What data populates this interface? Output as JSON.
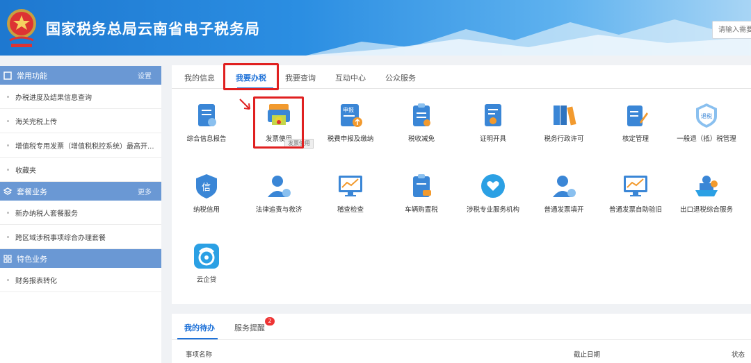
{
  "header": {
    "title": "国家税务总局云南省电子税务局",
    "search_placeholder": "请输入需要"
  },
  "sidebar": {
    "sections": [
      {
        "title": "常用功能",
        "more": "设置",
        "items": [
          "办税进度及结果信息查询",
          "海关完税上传",
          "增值税专用发票（增值税税控系统）最高开...",
          "收藏夹"
        ]
      },
      {
        "title": "套餐业务",
        "more": "更多",
        "items": [
          "新办纳税人套餐服务",
          "跨区域涉税事项综合办理套餐"
        ]
      },
      {
        "title": "特色业务",
        "more": "",
        "items": [
          "财务报表转化"
        ]
      }
    ]
  },
  "main": {
    "tabs": [
      "我的信息",
      "我要办税",
      "我要查询",
      "互动中心",
      "公众服务"
    ],
    "active_tab": "我要办税",
    "services": [
      "综合信息报告",
      "发票使用",
      "税费申报及缴纳",
      "税收减免",
      "证明开具",
      "税务行政许可",
      "核定管理",
      "一般退（抵）税管理",
      "纳税信用",
      "法律追责与救济",
      "稽查检查",
      "车辆购置税",
      "涉税专业服务机构",
      "普通发票填开",
      "普通发票自助验旧",
      "出口退税综合服务",
      "云企贷"
    ],
    "tooltip": "发票使用",
    "icon_labels": {
      "shenbao": "申报",
      "tuishui": "退税",
      "xin": "信"
    }
  },
  "todo": {
    "tabs": [
      "我的待办",
      "服务提醒"
    ],
    "badge": "2",
    "columns": [
      "事项名称",
      "截止日期",
      "状态"
    ]
  },
  "colors": {
    "primary": "#1f72d8",
    "sidebar_head": "#6a98d4",
    "highlight": "#e02020"
  }
}
